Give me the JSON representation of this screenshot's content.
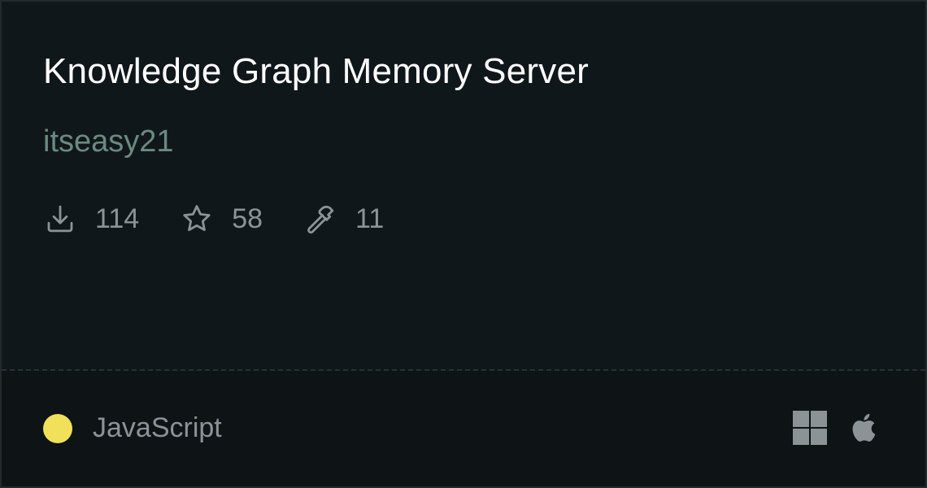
{
  "card": {
    "title": "Knowledge Graph Memory Server",
    "author": "itseasy21",
    "stats": {
      "downloads": {
        "icon": "download-icon",
        "value": "114"
      },
      "stars": {
        "icon": "star-icon",
        "value": "58"
      },
      "tools": {
        "icon": "hammer-icon",
        "value": "11"
      }
    },
    "language": {
      "name": "JavaScript",
      "color": "#f1e05a"
    },
    "platforms": [
      "windows-icon",
      "apple-icon"
    ]
  },
  "colors": {
    "background": "#10171a",
    "footer_background": "#0e1315",
    "title": "#ffffff",
    "author": "#6b8a80",
    "muted_text": "#8b9396",
    "icon": "#8b9396"
  }
}
